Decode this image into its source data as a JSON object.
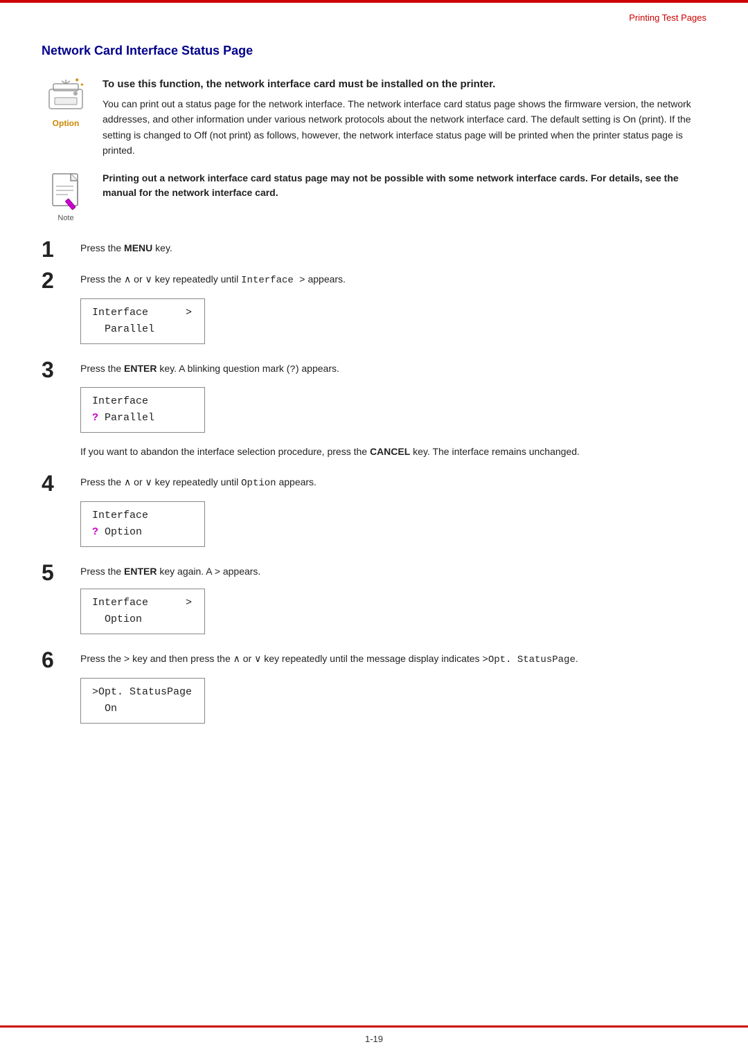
{
  "header": {
    "top_title": "Printing Test Pages"
  },
  "section": {
    "heading": "Network Card Interface Status Page"
  },
  "option_block": {
    "icon_label": "Option",
    "bold_intro": "To use this function, the network interface card must be installed on the printer.",
    "body_text": "You can print out a status page for the network interface. The network interface card status page shows the firmware version, the network addresses, and other information under various network protocols about the network interface card. The default setting is On (print). If the setting is changed to Off (not print) as follows, however, the network interface status page will be printed when the printer status page is printed."
  },
  "note_block": {
    "icon_label": "Note",
    "bold_text": "Printing out a network interface card status page may not be possible with some network interface cards. For details, see the manual for the network interface card."
  },
  "steps": [
    {
      "number": "1",
      "text_parts": [
        "Press the ",
        "MENU",
        " key."
      ],
      "has_bold": true,
      "bold_word": "MENU",
      "lcd": null
    },
    {
      "number": "2",
      "text_before": "Press the ",
      "key_up": "∧",
      "text_mid": " or ",
      "key_down": "∨",
      "text_after": " key repeatedly until ",
      "mono_word": "Interface  >",
      "text_end": " appears.",
      "lcd": {
        "line1": "Interface      >",
        "line2": "  Parallel"
      }
    },
    {
      "number": "3",
      "text_before": "Press the ",
      "bold_word": "ENTER",
      "text_after": " key. A blinking question mark (",
      "mono_char": "?",
      "text_end": ") appears.",
      "lcd": {
        "line1": "Interface",
        "line2_prefix": "? Parallel",
        "has_cursor": true
      },
      "note_text": "If you want to abandon the interface selection procedure, press the CANCEL key. The interface remains unchanged."
    },
    {
      "number": "4",
      "text_before": "Press the ",
      "key_up": "∧",
      "text_mid": " or ",
      "key_down": "∨",
      "text_after": " key repeatedly until ",
      "mono_word": "Option",
      "text_end": " appears.",
      "lcd": {
        "line1": "Interface",
        "line2": "? Option",
        "has_cursor": true
      }
    },
    {
      "number": "5",
      "text_before": "Press the ",
      "bold_word": "ENTER",
      "text_after": " key again. A > appears.",
      "lcd": {
        "line1": "Interface      >",
        "line2": "  Option"
      }
    },
    {
      "number": "6",
      "text_before": "Press the > key and then press the ",
      "key_up": "∧",
      "text_mid": " or ",
      "key_down": "∨",
      "text_after": " key repeatedly until the message display indicates ",
      "mono_word": ">Opt. StatusPage",
      "text_end": ".",
      "lcd": {
        "line1": ">Opt. StatusPage",
        "line2": "  On"
      }
    }
  ],
  "footer": {
    "page_number": "1-19"
  }
}
